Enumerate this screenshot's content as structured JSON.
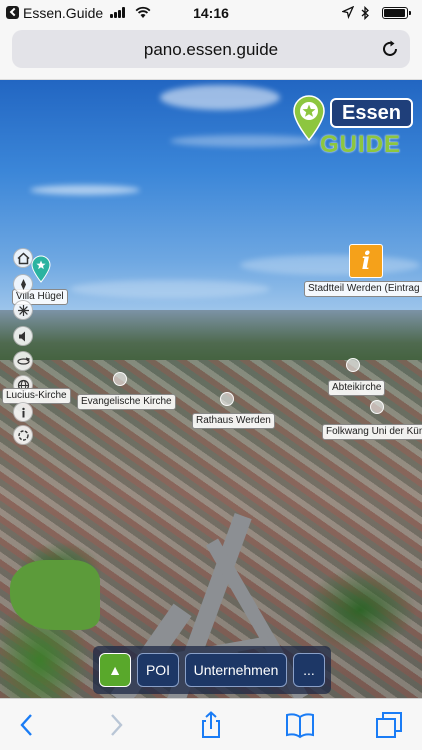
{
  "status_bar": {
    "app_name": "Essen.Guide",
    "time": "14:16",
    "battery_level": 0.95
  },
  "browser": {
    "url": "pano.essen.guide"
  },
  "logo": {
    "title": "Essen",
    "subtitle": "GUIDE"
  },
  "hotspots": {
    "villa": "Villa Hügel",
    "stadtteil": "Stadtteil Werden (Eintrag",
    "lucius": "Lucius-Kirche",
    "evangelische": "Evangelische Kirche",
    "abteikirche": "Abteikirche",
    "rathaus": "Rathaus Werden",
    "folkwang": "Folkwang Uni der Kün"
  },
  "info_hotspot": {
    "glyph": "i"
  },
  "menu": {
    "up_glyph": "▲",
    "poi": "POI",
    "unternehmen": "Unternehmen",
    "more": "..."
  },
  "colors": {
    "accent_green": "#59a82b",
    "brand_blue": "#1f3f7a",
    "ios_blue": "#1a7cf5",
    "info_orange": "#f5a11a"
  }
}
